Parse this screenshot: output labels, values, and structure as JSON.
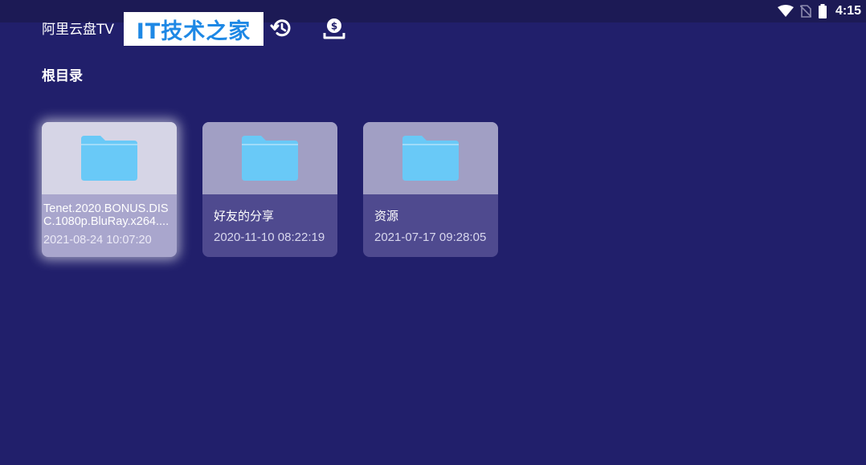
{
  "status_bar": {
    "time": "4:15",
    "icons": [
      "wifi-icon",
      "no-sim-icon",
      "battery-icon"
    ]
  },
  "header": {
    "app_title": "阿里云盘TV",
    "watermark": "IT技术之家",
    "icons": [
      "history-icon",
      "download-icon"
    ]
  },
  "breadcrumb": "根目录",
  "folders": [
    {
      "name": "Tenet.2020.BONUS.DISC.1080p.BluRay.x264....",
      "date": "2021-08-24 10:07:20",
      "focused": true
    },
    {
      "name": "好友的分享",
      "date": "2020-11-10 08:22:19",
      "focused": false
    },
    {
      "name": "资源",
      "date": "2021-07-17 09:28:05",
      "focused": false
    }
  ],
  "colors": {
    "background": "#211f6b",
    "status_bar": "#1c1a55",
    "folder_icon": "#69c9f7",
    "watermark_text": "#1e88e5"
  }
}
